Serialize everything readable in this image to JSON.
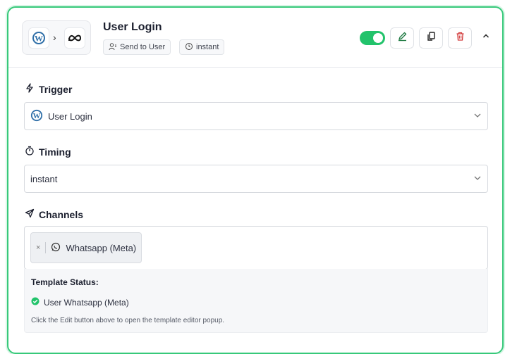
{
  "header": {
    "title": "User Login",
    "tags": [
      {
        "label": "Send to User",
        "icon": "users-icon"
      },
      {
        "label": "instant",
        "icon": "clock-icon"
      }
    ],
    "toggle_on": true,
    "accent": "#22c36b",
    "icons": [
      "wordpress-icon",
      "meta-icon",
      "pencil-icon",
      "copy-icon",
      "trash-icon",
      "chevron-up-icon"
    ]
  },
  "trigger": {
    "label": "Trigger",
    "selected": "User Login",
    "icon": "wordpress-icon"
  },
  "timing": {
    "label": "Timing",
    "selected": "instant"
  },
  "channels": {
    "label": "Channels",
    "chips": [
      {
        "label": "Whatsapp (Meta)",
        "icon": "whatsapp-icon"
      }
    ],
    "remove_glyph": "×"
  },
  "template_status": {
    "title": "Template Status:",
    "items": [
      {
        "label": "User Whatsapp (Meta)",
        "status": "ok",
        "color": "#22c36b"
      }
    ],
    "note": "Click the Edit button above to open the template editor popup."
  }
}
